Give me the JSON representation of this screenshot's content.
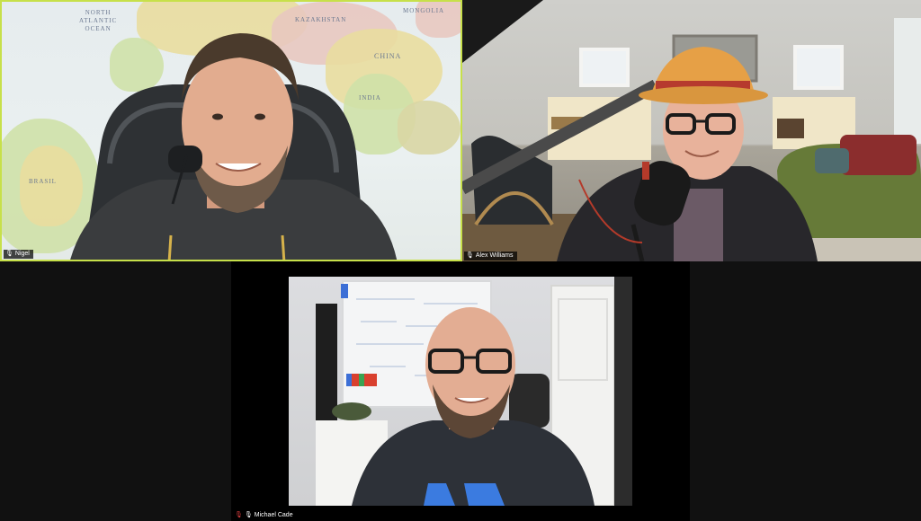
{
  "participants": [
    {
      "name": "Nigel",
      "muted": false,
      "active_speaker": true
    },
    {
      "name": "Alex Williams",
      "muted": false,
      "active_speaker": false
    },
    {
      "name": "Michael Cade",
      "muted": true,
      "active_speaker": false
    }
  ],
  "map_labels": {
    "north_atlantic": "NORTH\nATLANTIC\nOCEAN",
    "china": "CHINA",
    "india": "INDIA",
    "brasil": "BRASIL",
    "kazakhstan": "KAZAKHSTAN",
    "mongolia": "MONGOLIA"
  },
  "colors": {
    "active_border": "#c7e04a",
    "muted_mic": "#e04040",
    "background": "#111111"
  },
  "icons": {
    "mic": "microphone-icon",
    "mic_muted": "muted-microphone-icon"
  }
}
